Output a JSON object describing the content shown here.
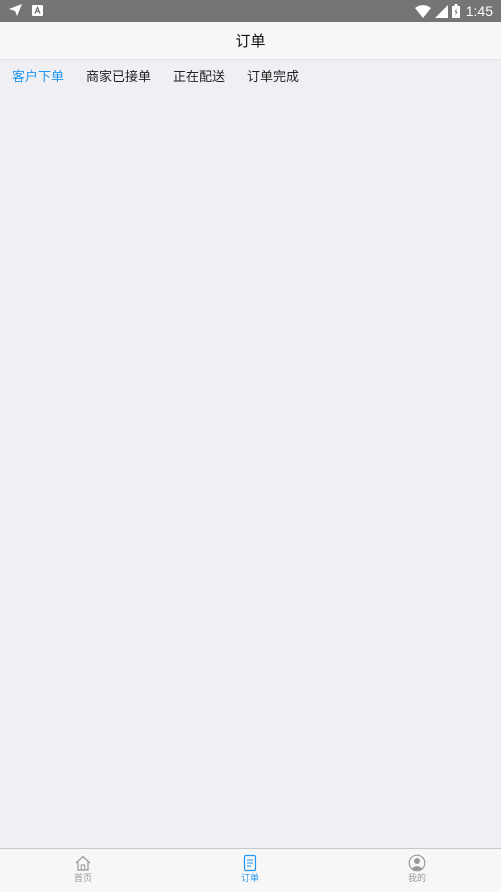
{
  "status_bar": {
    "time": "1:45",
    "icons": [
      "send-icon",
      "notification-a-icon",
      "wifi-icon",
      "signal-icon",
      "battery-icon"
    ]
  },
  "navbar": {
    "title": "订单"
  },
  "tabs": [
    {
      "label": "客户下单",
      "active": true
    },
    {
      "label": "商家已接单",
      "active": false
    },
    {
      "label": "正在配送",
      "active": false
    },
    {
      "label": "订单完成",
      "active": false
    }
  ],
  "bottom_nav": [
    {
      "label": "首页",
      "icon": "home-icon",
      "active": false
    },
    {
      "label": "订单",
      "icon": "orders-icon",
      "active": true
    },
    {
      "label": "我的",
      "icon": "profile-icon",
      "active": false
    }
  ],
  "colors": {
    "accent": "#2196f3",
    "status_bar": "#757575",
    "background": "#efeff4",
    "inactive": "#9a9a9a"
  }
}
